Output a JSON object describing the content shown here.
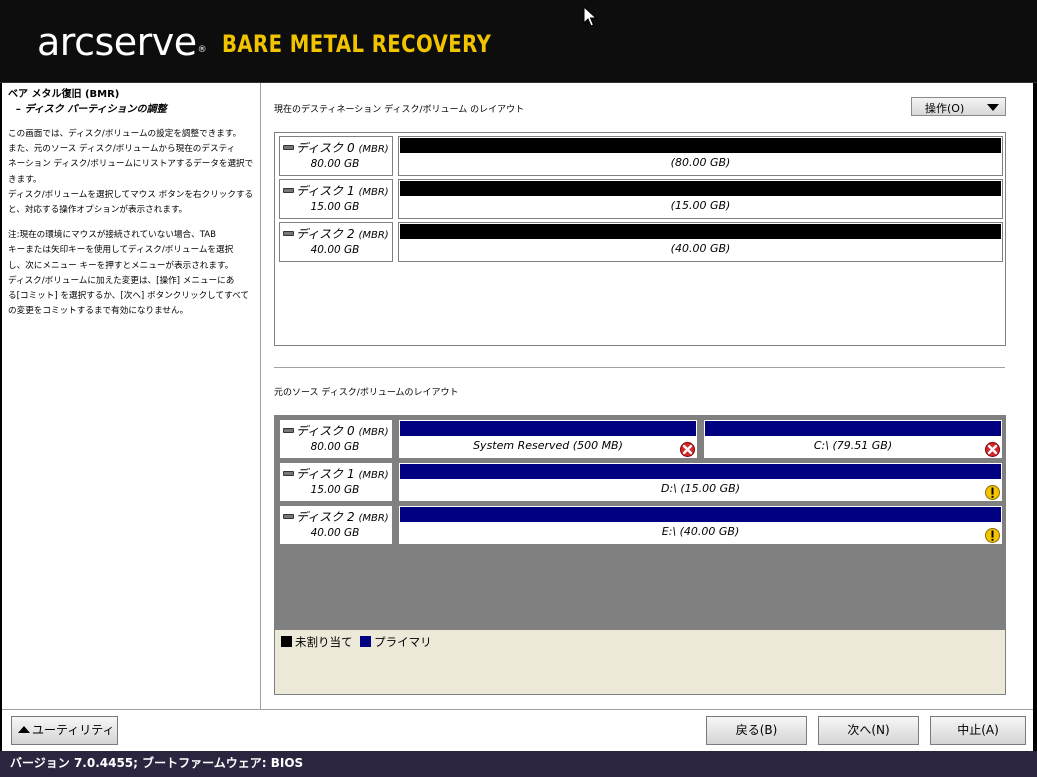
{
  "header": {
    "logo_text": "arcserve",
    "logo_reg": "®",
    "product_name": "BARE METAL RECOVERY",
    "product_color": "#f2c400"
  },
  "help": {
    "title": "ベア メタル復旧 (BMR)",
    "subtitle": "– ディスク パーティションの調整",
    "paragraphs": [
      "この画面では、ディスク/ボリュームの設定を調整できます。\nまた、元のソース ディスク/ボリュームから現在のデスティ\nネーション ディスク/ボリュームにリストアするデータを選択で\nきます。\nディスク/ボリュームを選択してマウス ボタンを右クリックする\nと、対応する操作オプションが表示されます。",
      "注:現在の環境にマウスが接続されていない場合、TAB\nキーまたは矢印キーを使用してディスク/ボリュームを選択\nし、次にメニュー キーを押すとメニューが表示されます。\nディスク/ボリュームに加えた変更は、[操作] メニューにあ\nる[コミット] を選択するか、[次へ] ボタンクリックしてすべて\nの変更をコミットするまで有効になりません。"
    ]
  },
  "destination": {
    "label": "現在のデスティネーション ディスク/ボリューム のレイアウト",
    "operations_button": "操作(O)",
    "disks": [
      {
        "name": "ディスク 0",
        "type": "(MBR)",
        "size": "80.00 GB",
        "partitions": [
          {
            "label": "(80.00 GB)",
            "kind": "unallocated",
            "status": "none"
          }
        ]
      },
      {
        "name": "ディスク 1",
        "type": "(MBR)",
        "size": "15.00 GB",
        "partitions": [
          {
            "label": "(15.00 GB)",
            "kind": "unallocated",
            "status": "none"
          }
        ]
      },
      {
        "name": "ディスク 2",
        "type": "(MBR)",
        "size": "40.00 GB",
        "partitions": [
          {
            "label": "(40.00 GB)",
            "kind": "unallocated",
            "status": "none"
          }
        ]
      }
    ]
  },
  "source": {
    "label": "元のソース ディスク/ボリュームのレイアウト",
    "disks": [
      {
        "name": "ディスク 0",
        "type": "(MBR)",
        "size": "80.00 GB",
        "partitions": [
          {
            "label": "System Reserved (500 MB)",
            "kind": "primary",
            "status": "error"
          },
          {
            "label": "C:\\ (79.51 GB)",
            "kind": "primary",
            "status": "error"
          }
        ]
      },
      {
        "name": "ディスク 1",
        "type": "(MBR)",
        "size": "15.00 GB",
        "partitions": [
          {
            "label": "D:\\ (15.00 GB)",
            "kind": "primary",
            "status": "warning"
          }
        ]
      },
      {
        "name": "ディスク 2",
        "type": "(MBR)",
        "size": "40.00 GB",
        "partitions": [
          {
            "label": "E:\\ (40.00 GB)",
            "kind": "primary",
            "status": "warning"
          }
        ]
      }
    ]
  },
  "legend": {
    "unallocated": "未割り当て",
    "unallocated_color": "#000000",
    "primary": "プライマリ",
    "primary_color": "#000080"
  },
  "buttons": {
    "utility": "ユーティリティ(U)",
    "back": "戻る(B)",
    "next": "次へ(N)",
    "abort": "中止(A)"
  },
  "status_bar": {
    "text": "バージョン 7.0.4455; ブートファームウェア: BIOS"
  }
}
